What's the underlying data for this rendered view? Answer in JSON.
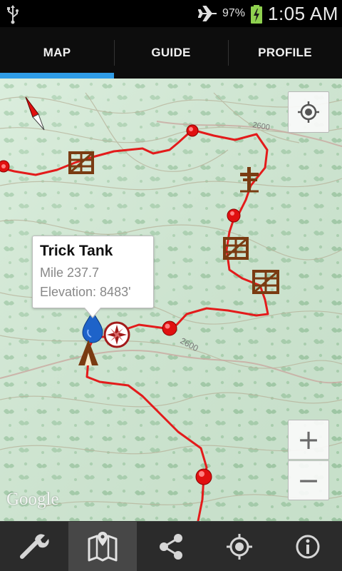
{
  "status_bar": {
    "battery_percent": "97%",
    "time": "1:05 AM",
    "icons": [
      "usb-icon",
      "airplane-mode-icon",
      "battery-charging-icon"
    ]
  },
  "tabs": [
    {
      "label": "MAP",
      "active": true
    },
    {
      "label": "GUIDE",
      "active": false
    },
    {
      "label": "PROFILE",
      "active": false
    }
  ],
  "map": {
    "contour_labels": [
      "2600",
      "2600"
    ],
    "attribution": "Google",
    "trail_color": "#e31b1b",
    "controls": {
      "zoom_in": "+",
      "zoom_out": "−",
      "locate": "locate-icon"
    },
    "callout": {
      "title": "Trick Tank",
      "mile": "Mile 237.7",
      "elevation": "Elevation: 8483'"
    },
    "markers": [
      "compass-north-icon",
      "gate-icon",
      "gate-icon",
      "gate-icon",
      "trail-junction-icon",
      "water-drop-icon",
      "compass-rose-icon",
      "campsite-icon",
      "waypoint-dot"
    ]
  },
  "toolbar": {
    "items": [
      {
        "name": "settings-wrench-icon",
        "active": false
      },
      {
        "name": "map-icon",
        "active": true
      },
      {
        "name": "share-icon",
        "active": false
      },
      {
        "name": "gps-locate-icon",
        "active": false
      },
      {
        "name": "info-icon",
        "active": false
      }
    ]
  }
}
